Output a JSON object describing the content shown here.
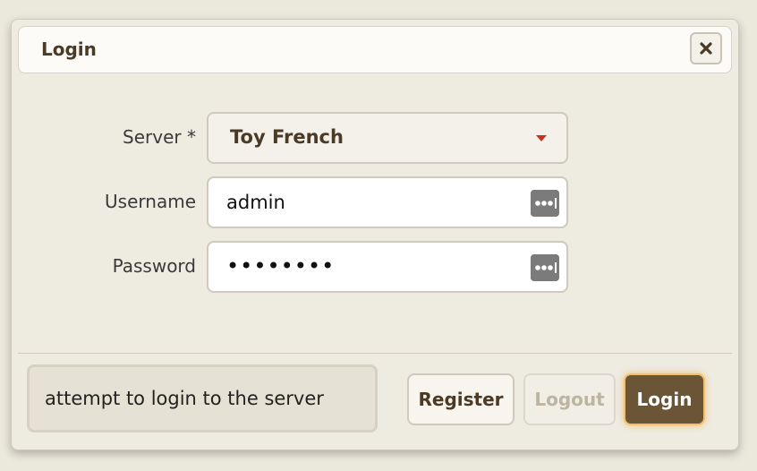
{
  "dialog": {
    "title": "Login",
    "close_icon": "close-icon"
  },
  "form": {
    "server": {
      "label": "Server *",
      "value": "Toy French"
    },
    "username": {
      "label": "Username",
      "value": "admin",
      "icon": "password-manager-icon"
    },
    "password": {
      "label": "Password",
      "value": "••••••••",
      "icon": "password-manager-icon"
    }
  },
  "footer": {
    "status": "attempt to login to the server",
    "register_label": "Register",
    "logout_label": "Logout",
    "login_label": "Login"
  },
  "colors": {
    "accent": "#6a5536",
    "title_text": "#4a3a26",
    "dropdown_arrow": "#c7341c",
    "disabled_text": "#bdb4a2",
    "glow": "#f4b446"
  }
}
